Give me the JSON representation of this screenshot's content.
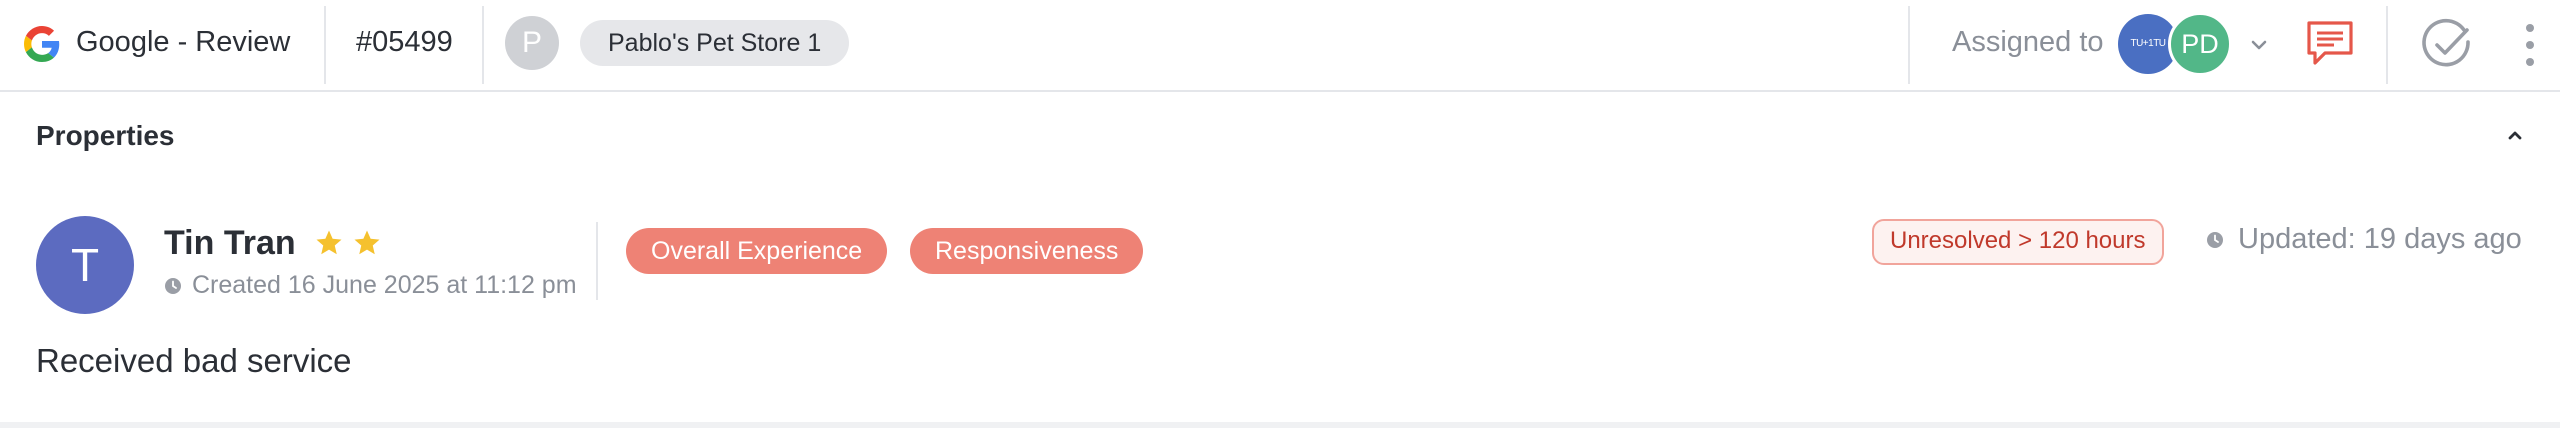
{
  "header": {
    "channel_label": "Google - Review",
    "ticket_id": "#05499",
    "store_avatar_initial": "P",
    "store_name": "Pablo's Pet Store 1",
    "assigned_label": "Assigned to",
    "assignees": [
      {
        "initials": "TU+1TU",
        "color": "#4a6fc2"
      },
      {
        "initials": "PD",
        "color": "#52b788"
      }
    ],
    "icons": [
      "google-g-icon",
      "chevron-down-icon",
      "chat-icon",
      "check-circle-icon",
      "kebab-icon"
    ],
    "accent_color": "#e5574a"
  },
  "properties": {
    "title": "Properties",
    "collapse_icon": "chevron-up-icon"
  },
  "review": {
    "avatar_initial": "T",
    "author": "Tin Tran",
    "rating": 2,
    "created": "Created 16 June 2025 at 11:12 pm",
    "tags": [
      "Overall Experience",
      "Responsiveness"
    ],
    "sla_badge": "Unresolved > 120 hours",
    "updated": "Updated: 19 days ago",
    "text": "Received bad service",
    "colors": {
      "avatar": "#5c6bc0",
      "tag": "#ee8275",
      "star": "#f5c12e",
      "sla_text": "#c0392b"
    }
  }
}
